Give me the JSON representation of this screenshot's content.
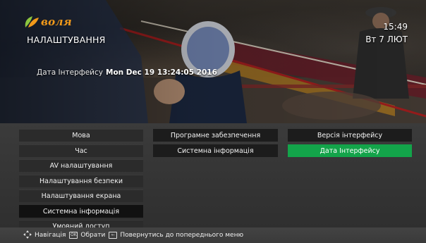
{
  "header": {
    "brand": "воля",
    "page_title": "НАЛАШТУВАННЯ",
    "time": "15:49",
    "date": "Вт 7 ЛЮТ"
  },
  "info": {
    "label": "Дата Інтерфейсу",
    "value": "Mon Dec 19 13:24:05 2016"
  },
  "menu": {
    "column1": [
      {
        "label": "Мова"
      },
      {
        "label": "Час"
      },
      {
        "label": "AV налаштування"
      },
      {
        "label": "Налаштування безпеки"
      },
      {
        "label": "Налаштування екрана"
      },
      {
        "label": "Системна інформація",
        "state": "selected"
      },
      {
        "label": "Умовний доступ"
      }
    ],
    "column2": [
      {
        "label": "Програмне забезпечення"
      },
      {
        "label": "Системна інформація",
        "state": "selected"
      }
    ],
    "column3": [
      {
        "label": "Версія інтерфейсу"
      },
      {
        "label": "Дата Інтерфейсу",
        "state": "active"
      }
    ]
  },
  "footer": {
    "nav_label": "Навігація",
    "ok_label": "Обрати",
    "back_label": "Повернутись до попереднього меню",
    "ok_key": "OK",
    "back_key": "←"
  },
  "colors": {
    "accent_green": "#13a44a",
    "brand_orange": "#f29a1a"
  }
}
